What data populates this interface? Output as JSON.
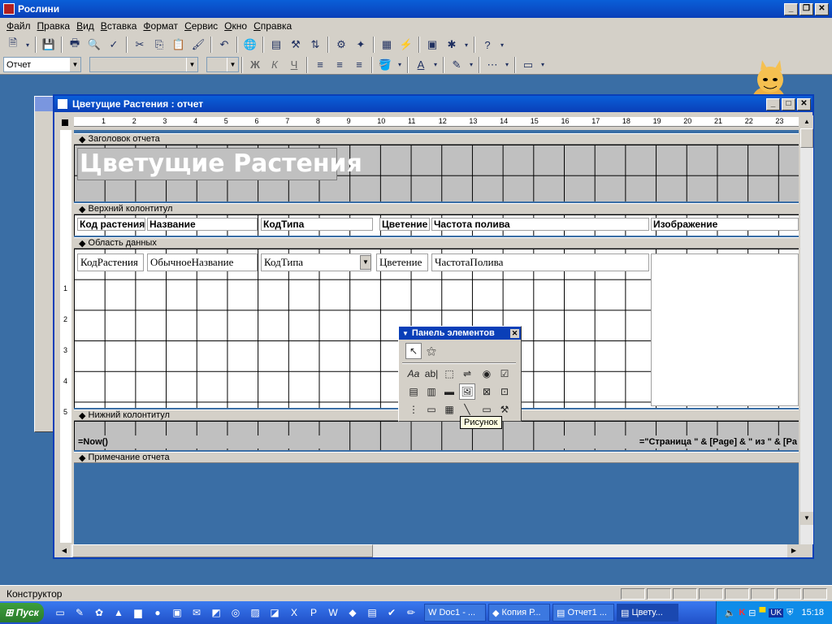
{
  "app": {
    "title": "Рослини"
  },
  "menu": [
    "Файл",
    "Правка",
    "Вид",
    "Вставка",
    "Формат",
    "Сервис",
    "Окно",
    "Справка"
  ],
  "toolbar": {
    "object_combo": "Отчет",
    "font_combo": "",
    "size_combo": "",
    "bold": "Ж",
    "italic": "К",
    "underline": "Ч"
  },
  "report_window": {
    "title": "Цветущие Растения : отчет",
    "ruler_ticks": [
      "1",
      "2",
      "3",
      "4",
      "5",
      "6",
      "7",
      "8",
      "9",
      "10",
      "11",
      "12",
      "13",
      "14",
      "15",
      "16",
      "17",
      "18",
      "19",
      "20",
      "21",
      "22",
      "23"
    ],
    "vruler_ticks": [
      "1",
      "2",
      "3",
      "4",
      "5"
    ],
    "sections": {
      "report_header": "Заголовок отчета",
      "page_header": "Верхний колонтитул",
      "detail": "Область данных",
      "page_footer": "Нижний колонтитул",
      "report_footer": "Примечание отчета"
    },
    "report_title": "Цветущие Растения",
    "header_labels": [
      "Код растения",
      "Название",
      "КодТипа",
      "Цветение",
      "Частота полива",
      "Изображение"
    ],
    "detail_fields": [
      "КодРастения",
      "ОбычноеНазвание",
      "КодТипа",
      "Цветение",
      "ЧастотаПолива"
    ],
    "footer_left": "=Now()",
    "footer_right": "=\"Страница \" & [Page] & \" из \" & [Pa"
  },
  "toolbox": {
    "title": "Панель элементов",
    "tooltip": "Рисунок",
    "tools": [
      "select-tool",
      "wizard-tool",
      "label-tool",
      "textbox-tool",
      "frame-tool",
      "toggle-tool",
      "option-tool",
      "checkbox-tool",
      "combo-tool",
      "list-tool",
      "button-tool",
      "image-tool",
      "unbound-frame-tool",
      "bound-frame-tool",
      "pagebreak-tool",
      "tab-tool",
      "subform-tool",
      "line-tool",
      "rectangle-tool",
      "more-tools"
    ]
  },
  "status": {
    "text": "Конструктор"
  },
  "taskbar": {
    "start": "Пуск",
    "tasks": [
      "Doc1 - ...",
      "Копия Р...",
      "Отчет1 ...",
      "Цвету..."
    ],
    "clock": "15:18",
    "lang": "UK"
  }
}
